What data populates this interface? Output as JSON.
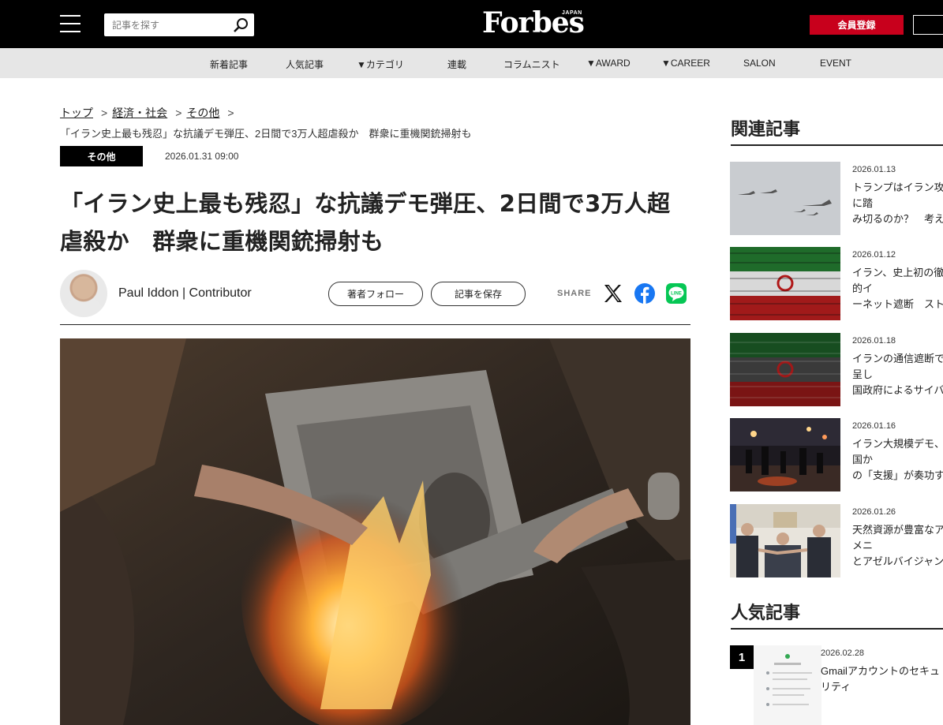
{
  "header": {
    "search_placeholder": "記事を探す",
    "logo": "Forbes",
    "logo_sub": "JAPAN",
    "register_label": "会員登録",
    "colors": {
      "topbar": "#000000",
      "accent": "#c8001c",
      "nav": "#e6e6e6"
    }
  },
  "nav": {
    "items": [
      "新着記事",
      "人気記事",
      "▼カテゴリ",
      "連載",
      "コラムニスト",
      "▼AWARD",
      "▼CAREER",
      "SALON",
      "EVENT"
    ]
  },
  "breadcrumb": {
    "items": [
      "トップ",
      "経済・社会",
      "その他"
    ],
    "current": "「イラン史上最も残忍」な抗議デモ弾圧、2日間で3万人超虐殺か　群衆に重機関銃掃射も"
  },
  "article": {
    "category": "その他",
    "date": "2026.01.31 09:00",
    "title": "「イラン史上最も残忍」な抗議デモ弾圧、2日間で3万人超虐殺か　群衆に重機関銃掃射も",
    "author": "Paul Iddon | Contributor",
    "follow_label": "著者フォロー",
    "save_label": "記事を保存",
    "share_label": "SHARE",
    "share_icons": [
      "x-icon",
      "facebook-icon",
      "line-icon"
    ]
  },
  "sidebar": {
    "related_heading": "関連記事",
    "related": [
      {
        "date": "2026.01.13",
        "title": "トランプはイラン攻撃に踏\nみ切るのか？　考えられる\n事作戦と、その実効性"
      },
      {
        "date": "2026.01.12",
        "title": "イラン、史上初の徹底的イ\nーネット遮断　ストライキ\nに「キルスイッチ」発動"
      },
      {
        "date": "2026.01.18",
        "title": "イランの通信遮断で露呈し\n国政府によるサイバー「鎖\n動」の実態"
      },
      {
        "date": "2026.01.16",
        "title": "イラン大規模デモ、米国か\nの「支援」が奏功する可能\nの条件"
      },
      {
        "date": "2026.01.26",
        "title": "天然資源が豊富なアルメニ\nとアゼルバイジャン、和平\nる米国の思惑"
      }
    ],
    "popular_heading": "人気記事",
    "popular": [
      {
        "rank": "1",
        "date": "2026.02.28",
        "title": "Gmailアカウントのセキュリティ\nすぐ確認せよ、攻撃が進行中"
      }
    ]
  }
}
